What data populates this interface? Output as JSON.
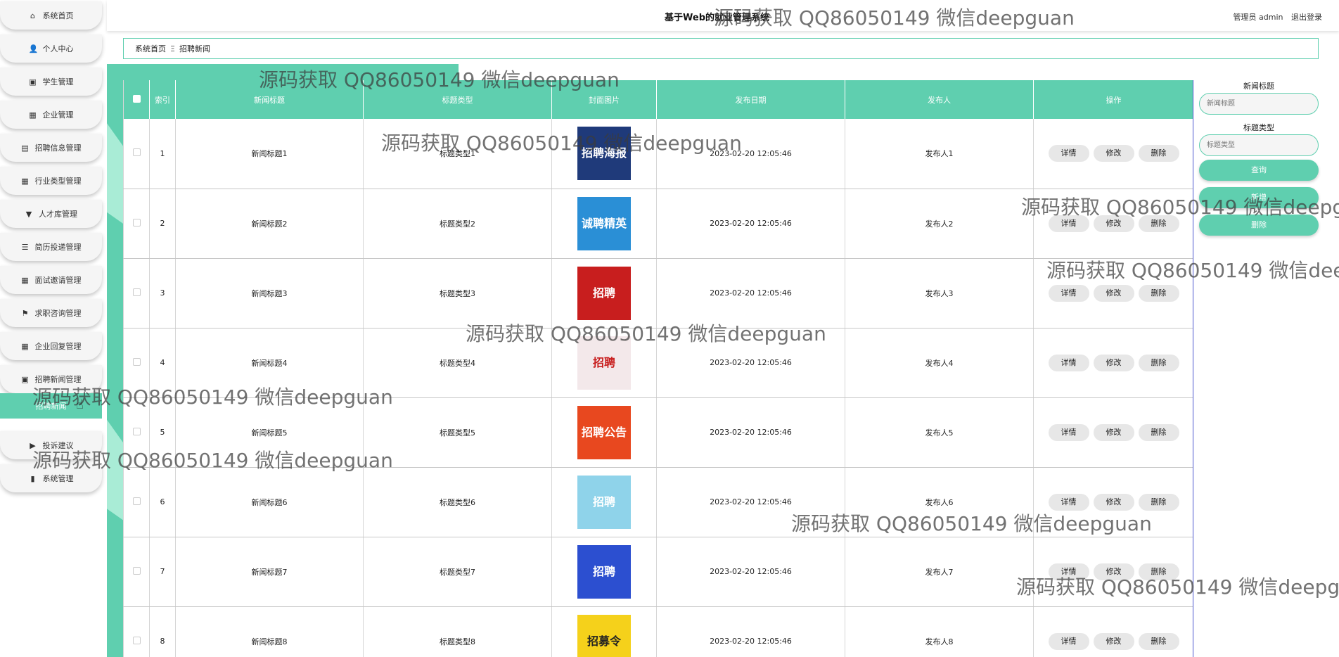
{
  "app": {
    "title": "基于Web的就业管理系统",
    "user_label": "管理员 admin",
    "logout_label": "退出登录"
  },
  "sidebar": {
    "items": [
      {
        "label": "系统首页",
        "icon": "home-icon"
      },
      {
        "label": "个人中心",
        "icon": "user-icon"
      },
      {
        "label": "学生管理",
        "icon": "clipboard-icon"
      },
      {
        "label": "企业管理",
        "icon": "grid-icon"
      },
      {
        "label": "招聘信息管理",
        "icon": "chart-icon"
      },
      {
        "label": "行业类型管理",
        "icon": "grid-icon"
      },
      {
        "label": "人才库管理",
        "icon": "pin-icon"
      },
      {
        "label": "简历投递管理",
        "icon": "list-icon"
      },
      {
        "label": "面试邀请管理",
        "icon": "grid-icon"
      },
      {
        "label": "求职咨询管理",
        "icon": "flag-icon"
      },
      {
        "label": "企业回复管理",
        "icon": "grid-icon"
      },
      {
        "label": "招聘新闻管理",
        "icon": "clipboard-icon"
      },
      {
        "label": "招聘新闻",
        "icon": "",
        "active": true
      },
      {
        "label": "投诉建议",
        "icon": "video-icon"
      },
      {
        "label": "系统管理",
        "icon": "database-icon"
      }
    ]
  },
  "breadcrumb": {
    "home": "系统首页",
    "separator": "Ξ",
    "current": "招聘新闻"
  },
  "table": {
    "headers": [
      "索引",
      "新闻标题",
      "标题类型",
      "封面图片",
      "发布日期",
      "发布人",
      "操作"
    ],
    "rows": [
      {
        "index": "1",
        "title": "新闻标题1",
        "type": "标题类型1",
        "date": "2023-02-20 12:05:46",
        "publisher": "发布人1",
        "cover_text": "招聘海报",
        "cover_color": "#1f3a7a"
      },
      {
        "index": "2",
        "title": "新闻标题2",
        "type": "标题类型2",
        "date": "2023-02-20 12:05:46",
        "publisher": "发布人2",
        "cover_text": "诚聘精英",
        "cover_color": "#2a8fd6"
      },
      {
        "index": "3",
        "title": "新闻标题3",
        "type": "标题类型3",
        "date": "2023-02-20 12:05:46",
        "publisher": "发布人3",
        "cover_text": "招聘",
        "cover_color": "#c81e1e"
      },
      {
        "index": "4",
        "title": "新闻标题4",
        "type": "标题类型4",
        "date": "2023-02-20 12:05:46",
        "publisher": "发布人4",
        "cover_text": "招聘",
        "cover_color": "#f3e8ea"
      },
      {
        "index": "5",
        "title": "新闻标题5",
        "type": "标题类型5",
        "date": "2023-02-20 12:05:46",
        "publisher": "发布人5",
        "cover_text": "招聘公告",
        "cover_color": "#e8481f"
      },
      {
        "index": "6",
        "title": "新闻标题6",
        "type": "标题类型6",
        "date": "2023-02-20 12:05:46",
        "publisher": "发布人6",
        "cover_text": "招聘",
        "cover_color": "#8fd3ea"
      },
      {
        "index": "7",
        "title": "新闻标题7",
        "type": "标题类型7",
        "date": "2023-02-20 12:05:46",
        "publisher": "发布人7",
        "cover_text": "招聘",
        "cover_color": "#2c4fd0"
      },
      {
        "index": "8",
        "title": "新闻标题8",
        "type": "标题类型8",
        "date": "2023-02-20 12:05:46",
        "publisher": "发布人8",
        "cover_text": "招募令",
        "cover_color": "#f5d11b"
      }
    ],
    "actions": {
      "detail": "详情",
      "edit": "修改",
      "delete": "删除"
    }
  },
  "search": {
    "title_label": "新闻标题",
    "title_placeholder": "新闻标题",
    "type_label": "标题类型",
    "type_placeholder": "标题类型",
    "query_button": "查询",
    "add_button": "新增",
    "delete_button": "删除"
  },
  "watermark": "源码获取 QQ86050149 微信deepguan",
  "colors": {
    "accent": "#5fcfaf",
    "accent_light": "#a9ecd6"
  }
}
